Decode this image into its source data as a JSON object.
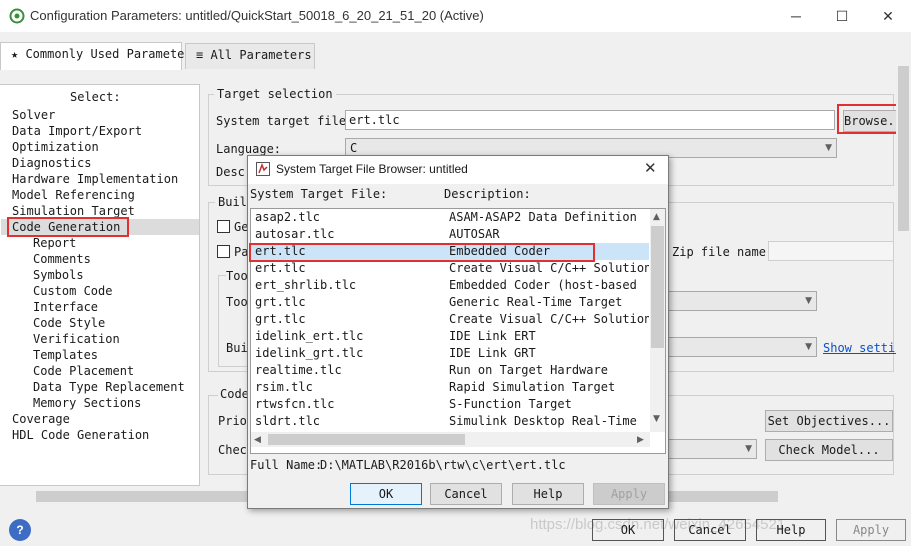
{
  "window": {
    "title": "Configuration Parameters: untitled/QuickStart_50018_6_20_21_51_20 (Active)",
    "minimize": "─",
    "maximize": "☐",
    "close": "✕"
  },
  "tabs": [
    {
      "label": "Commonly Used Parameters"
    },
    {
      "label": "All Parameters"
    }
  ],
  "tree": {
    "header": "Select:",
    "items": [
      "Solver",
      "Data Import/Export",
      "Optimization",
      "Diagnostics",
      "Hardware Implementation",
      "Model Referencing",
      "Simulation Target",
      "Code Generation"
    ],
    "children": [
      "Report",
      "Comments",
      "Symbols",
      "Custom Code",
      "Interface",
      "Code Style",
      "Verification",
      "Templates",
      "Code Placement",
      "Data Type Replacement",
      "Memory Sections"
    ],
    "after": [
      "Coverage",
      "HDL Code Generation"
    ]
  },
  "main": {
    "target_selection": "Target selection",
    "system_target_file_label": "System target file:",
    "system_target_file_value": "ert.tlc",
    "browse": "Browse...",
    "language_label": "Language:",
    "language_value": "C",
    "description_label": "Descr",
    "build_group": "Build",
    "gen_checkbox": "Ge",
    "pa_checkbox": "Pa",
    "zip_label": "Zip file name:",
    "toolchain_group": "Too",
    "toolchain_label": "Too",
    "build_config_label": "Bui",
    "show_settings": "Show settin",
    "code_group": "Code",
    "priority_label": "Prio",
    "check_label": "Check",
    "set_objectives": "Set Objectives...",
    "check_model": "Check Model..."
  },
  "bottom": {
    "help_icon": "?",
    "ok": "OK",
    "cancel": "Cancel",
    "help": "Help",
    "apply": "Apply",
    "watermark": "https://blog.csdn.net/weixin_42654521"
  },
  "dialog": {
    "title": "System Target File Browser: untitled",
    "col_file": "System Target File:",
    "col_desc": "Description:",
    "selected_index": 2,
    "rows": [
      {
        "file": "asap2.tlc",
        "desc": "ASAM-ASAP2 Data Definition"
      },
      {
        "file": "autosar.tlc",
        "desc": "AUTOSAR"
      },
      {
        "file": "ert.tlc",
        "desc": "Embedded Coder"
      },
      {
        "file": "ert.tlc",
        "desc": "Create Visual C/C++ Solution"
      },
      {
        "file": "ert_shrlib.tlc",
        "desc": "Embedded Coder (host-based"
      },
      {
        "file": "grt.tlc",
        "desc": "Generic Real-Time Target"
      },
      {
        "file": "grt.tlc",
        "desc": "Create Visual C/C++ Solution"
      },
      {
        "file": "idelink_ert.tlc",
        "desc": "IDE Link ERT"
      },
      {
        "file": "idelink_grt.tlc",
        "desc": "IDE Link GRT"
      },
      {
        "file": "realtime.tlc",
        "desc": "Run on Target Hardware"
      },
      {
        "file": "rsim.tlc",
        "desc": "Rapid Simulation Target"
      },
      {
        "file": "rtwsfcn.tlc",
        "desc": "S-Function Target"
      },
      {
        "file": "sldrt.tlc",
        "desc": "Simulink Desktop Real-Time"
      }
    ],
    "full_name_label": "Full Name:",
    "full_name_value": "D:\\MATLAB\\R2016b\\rtw\\c\\ert\\ert.tlc",
    "ok": "OK",
    "cancel": "Cancel",
    "help": "Help",
    "apply": "Apply"
  },
  "colors": {
    "highlight": "#e03030",
    "selection": "#cce4f7",
    "accent": "#0078d7"
  }
}
